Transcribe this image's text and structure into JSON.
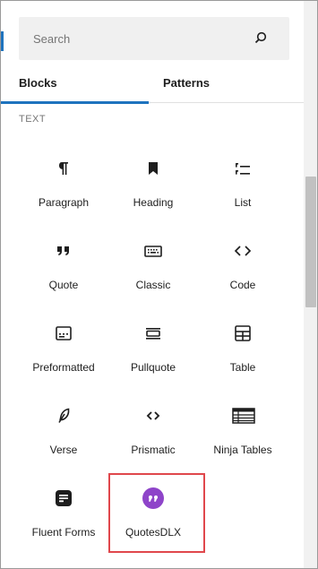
{
  "search": {
    "placeholder": "Search",
    "icon": "search-icon"
  },
  "tabs": [
    {
      "label": "Blocks",
      "active": true
    },
    {
      "label": "Patterns",
      "active": false
    }
  ],
  "category": {
    "label": "TEXT"
  },
  "blocks": [
    {
      "label": "Paragraph",
      "icon": "paragraph-icon"
    },
    {
      "label": "Heading",
      "icon": "heading-bookmark-icon"
    },
    {
      "label": "List",
      "icon": "list-icon"
    },
    {
      "label": "Quote",
      "icon": "quote-icon"
    },
    {
      "label": "Classic",
      "icon": "keyboard-icon"
    },
    {
      "label": "Code",
      "icon": "code-icon"
    },
    {
      "label": "Preformatted",
      "icon": "preformatted-icon"
    },
    {
      "label": "Pullquote",
      "icon": "pullquote-icon"
    },
    {
      "label": "Table",
      "icon": "table-icon"
    },
    {
      "label": "Verse",
      "icon": "feather-icon"
    },
    {
      "label": "Prismatic",
      "icon": "code-brackets-icon"
    },
    {
      "label": "Ninja Tables",
      "icon": "ninja-tables-icon"
    },
    {
      "label": "Fluent Forms",
      "icon": "fluent-forms-icon"
    },
    {
      "label": "QuotesDLX",
      "icon": "quotesdlx-icon"
    }
  ],
  "colors": {
    "accent": "#1e73be",
    "highlight": "#e0474c",
    "quotesdlx": "#8e44c9"
  }
}
